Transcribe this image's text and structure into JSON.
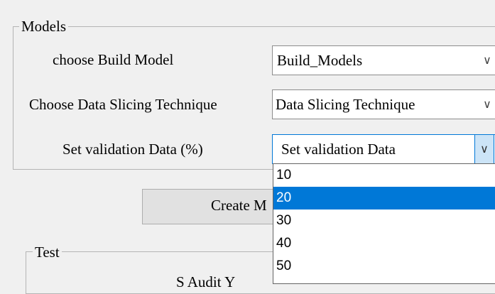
{
  "models": {
    "title": "Models",
    "build_label": "choose Build Model",
    "build_value": "Build_Models",
    "slicing_label": "Choose Data Slicing Technique",
    "slicing_value": "Data Slicing Technique",
    "validation_label": "Set validation Data (%)",
    "validation_value": "Set validation Data"
  },
  "create_button_label": "Create M",
  "dropdown": {
    "options": [
      "10",
      "20",
      "30",
      "40",
      "50"
    ],
    "selected": "20"
  },
  "test": {
    "title": "Test",
    "partial_text": "S Audit Y"
  },
  "icons": {
    "chevron": "chevron-down-icon"
  }
}
